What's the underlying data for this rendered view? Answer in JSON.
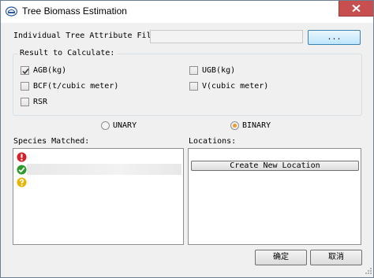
{
  "window": {
    "title": "Tree Biomass Estimation"
  },
  "file": {
    "label": "Individual Tree Attribute File:",
    "value": "",
    "browse_label": "..."
  },
  "results": {
    "group_label": "Result to Calculate:",
    "options": [
      {
        "label": "AGB(kg)",
        "checked": true
      },
      {
        "label": "UGB(kg)",
        "checked": false
      },
      {
        "label": "BCF(t/cubic meter)",
        "checked": false
      },
      {
        "label": "V(cubic meter)",
        "checked": false
      },
      {
        "label": "RSR",
        "checked": false
      }
    ]
  },
  "mode": {
    "options": [
      {
        "label": "UNARY",
        "selected": false
      },
      {
        "label": "BINARY",
        "selected": true
      }
    ]
  },
  "species": {
    "label": "Species Matched:",
    "rows": [
      {
        "status_icon": "error-icon",
        "color": "#d3202a"
      },
      {
        "status_icon": "check-icon",
        "color": "#2e9a2e"
      },
      {
        "status_icon": "question-icon",
        "color": "#e8b400"
      }
    ]
  },
  "locations": {
    "label": "Locations:",
    "create_label": "Create New Location"
  },
  "footer": {
    "ok_label": "确定",
    "cancel_label": "取消"
  },
  "colors": {
    "close_button": "#c74f50",
    "selected_radio": "#f09a2e",
    "focus_border": "#3c7fb1"
  }
}
